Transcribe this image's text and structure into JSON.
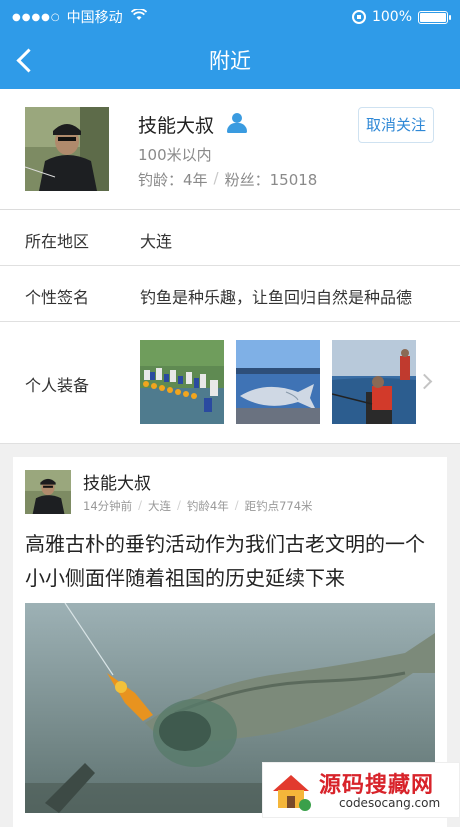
{
  "status_bar": {
    "signal_dots": "●●●●○",
    "carrier": "中国移动",
    "wifi_icon": "wifi-icon",
    "battery_percent": "100%",
    "battery_level": 1.0
  },
  "nav": {
    "title": "附近",
    "back_icon": "chevron-left-icon"
  },
  "profile": {
    "name": "技能大叔",
    "distance": "100米以内",
    "fishing_age": "钓龄：4年",
    "separator": "/",
    "fans": "粉丝：15018",
    "unfollow_label": "取消关注"
  },
  "details": {
    "region_label": "所在地区",
    "region_value": "大连",
    "signature_label": "个性签名",
    "signature_value": "钓鱼是种乐趣，让鱼回归自然是种品德",
    "gear_label": "个人装备"
  },
  "post": {
    "author": "技能大叔",
    "time": "14分钟前",
    "location": "大连",
    "fishing_age": "钓龄4年",
    "distance": "距钓点774米",
    "separator": "/",
    "title": "高雅古朴的垂钓活动作为我们古老文明的一个小小侧面伴随着祖国的历史延续下来"
  },
  "watermark": {
    "title": "源码搜藏网",
    "url": "codesocang.com"
  },
  "colors": {
    "accent": "#2f9be8",
    "link": "#2f88d6",
    "watermark_red": "#d8232a"
  }
}
